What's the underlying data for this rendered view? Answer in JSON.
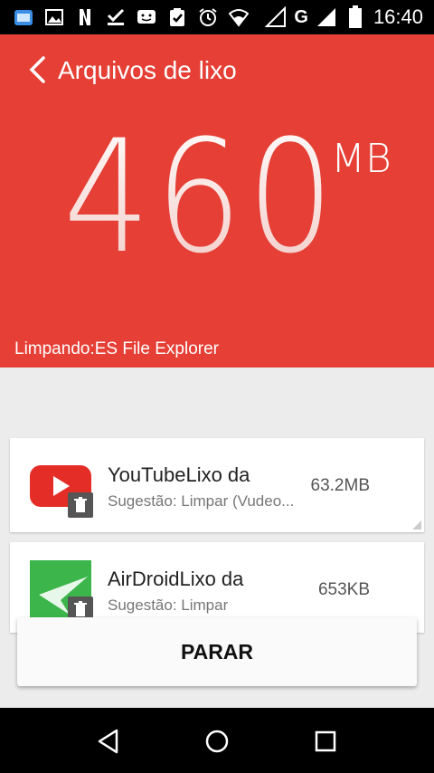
{
  "status_bar": {
    "time": "16:40",
    "network": "G",
    "icons": [
      "es-file-explorer-icon",
      "image-icon",
      "netflix-icon",
      "check-icon",
      "chat-icon",
      "clipboard-check-icon",
      "alarm-icon",
      "wifi-icon",
      "signal-icon",
      "battery-icon"
    ]
  },
  "header": {
    "title": "Arquivos de lixo",
    "size_value": "460",
    "size_unit": "MB",
    "cleaning_text": "Limpando:ES File Explorer",
    "background_color": "#e53f36"
  },
  "items": [
    {
      "app": "YouTubeLixo da",
      "suggestion": "Sugestão: Limpar (Vudeo...",
      "size": "63.2MB",
      "icon": "youtube-icon"
    },
    {
      "app": "AirDroidLixo da",
      "suggestion": "Sugestão: Limpar",
      "size": "653KB",
      "icon": "airdroid-icon"
    }
  ],
  "stop_button": {
    "label": "PARAR"
  },
  "nav_bar": {
    "buttons": [
      "back-icon",
      "home-icon",
      "recents-icon"
    ]
  }
}
